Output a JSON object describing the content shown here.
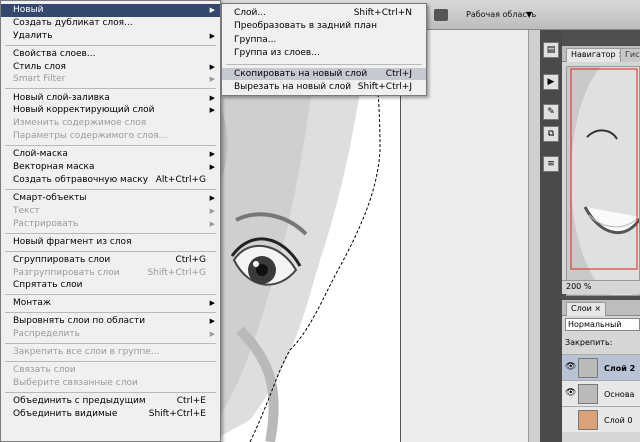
{
  "workspace": {
    "label": "Рабочая область"
  },
  "main_menu": {
    "groups": [
      [
        {
          "label": "Новый",
          "arrow": true,
          "highlight": "dark"
        },
        {
          "label": "Создать дубликат слоя..."
        },
        {
          "label": "Удалить",
          "arrow": true
        }
      ],
      [
        {
          "label": "Свойства слоев..."
        },
        {
          "label": "Стиль слоя",
          "arrow": true
        },
        {
          "label": "Smart Filter",
          "arrow": true,
          "disabled": true
        }
      ],
      [
        {
          "label": "Новый слой-заливка",
          "arrow": true
        },
        {
          "label": "Новый корректирующий слой",
          "arrow": true
        },
        {
          "label": "Изменить содержимое слоя",
          "disabled": true
        },
        {
          "label": "Параметры содержимого слоя...",
          "disabled": true
        }
      ],
      [
        {
          "label": "Слой-маска",
          "arrow": true
        },
        {
          "label": "Векторная маска",
          "arrow": true
        },
        {
          "label": "Создать обтравочную маску",
          "shortcut": "Alt+Ctrl+G"
        }
      ],
      [
        {
          "label": "Смарт-объекты",
          "arrow": true
        },
        {
          "label": "Текст",
          "arrow": true,
          "disabled": true
        },
        {
          "label": "Растрировать",
          "arrow": true,
          "disabled": true
        }
      ],
      [
        {
          "label": "Новый фрагмент из слоя"
        }
      ],
      [
        {
          "label": "Сгруппировать слои",
          "shortcut": "Ctrl+G"
        },
        {
          "label": "Разгруппировать слои",
          "shortcut": "Shift+Ctrl+G",
          "disabled": true
        },
        {
          "label": "Спрятать слои"
        }
      ],
      [
        {
          "label": "Монтаж",
          "arrow": true
        }
      ],
      [
        {
          "label": "Выровнять слои по области",
          "arrow": true
        },
        {
          "label": "Распределить",
          "arrow": true,
          "disabled": true
        }
      ],
      [
        {
          "label": "Закрепить все слои в группе...",
          "disabled": true
        }
      ],
      [
        {
          "label": "Связать слои",
          "disabled": true
        },
        {
          "label": "Выберите связанные слои",
          "disabled": true
        }
      ],
      [
        {
          "label": "Объединить с предыдущим",
          "shortcut": "Ctrl+E"
        },
        {
          "label": "Объединить видимые",
          "shortcut": "Shift+Ctrl+E"
        }
      ]
    ]
  },
  "sub_menu": {
    "items": [
      {
        "label": "Слой...",
        "shortcut": "Shift+Ctrl+N"
      },
      {
        "label": "Преобразовать в задний план"
      },
      {
        "label": "Группа..."
      },
      {
        "label": "Группа из слоев..."
      },
      {
        "label": "Скопировать на новый слой",
        "shortcut": "Ctrl+J",
        "highlight": "light"
      },
      {
        "label": "Вырезать на новый слой",
        "shortcut": "Shift+Ctrl+J"
      }
    ]
  },
  "navigator": {
    "tab_label": "Навигатор",
    "tab2_label": "Гист",
    "close": "×",
    "zoom": "200 %"
  },
  "layers": {
    "tab_label": "Слои",
    "close": "×",
    "blend_mode": "Нормальный",
    "lock_label": "Закрепить:",
    "rows": [
      {
        "name": "Слой 2",
        "active": true
      },
      {
        "name": "Основа"
      },
      {
        "name": "Слой 0"
      }
    ]
  },
  "colors": {
    "menu_bg": "#f0f0f0",
    "highlight_dark": "#34486e",
    "highlight_light": "#c6c9cf",
    "disabled": "#9a9a9a"
  }
}
